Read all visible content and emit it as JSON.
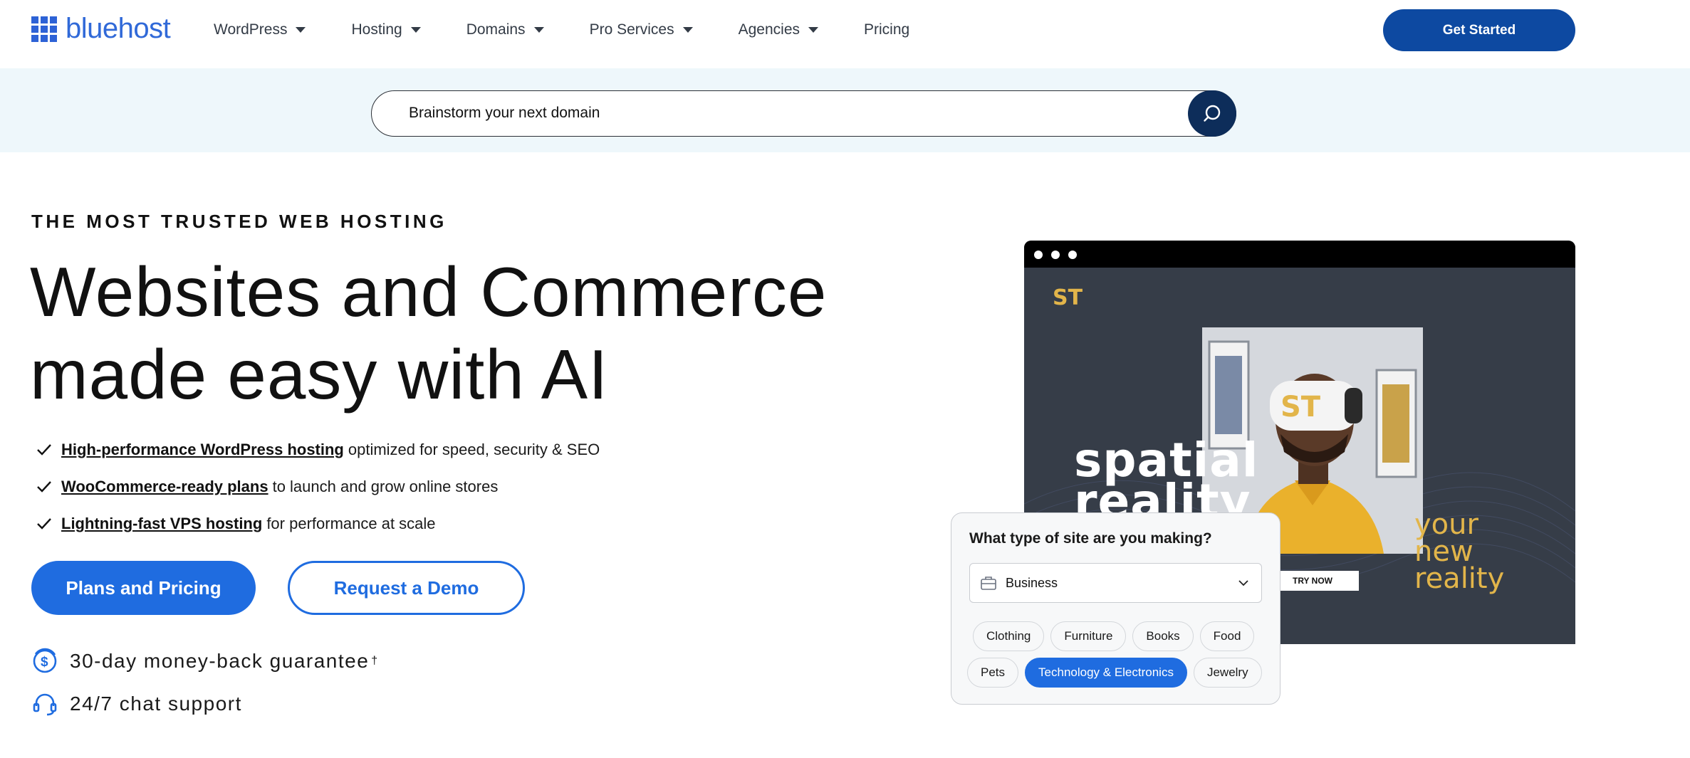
{
  "header": {
    "logo_text": "bluehost",
    "nav": [
      {
        "label": "WordPress",
        "has_dropdown": true
      },
      {
        "label": "Hosting",
        "has_dropdown": true
      },
      {
        "label": "Domains",
        "has_dropdown": true
      },
      {
        "label": "Pro Services",
        "has_dropdown": true
      },
      {
        "label": "Agencies",
        "has_dropdown": true
      },
      {
        "label": "Pricing",
        "has_dropdown": false
      }
    ],
    "cta_label": "Get Started"
  },
  "search": {
    "value": "Brainstorm your next domain",
    "icon": "search-icon"
  },
  "hero": {
    "eyebrow": "THE MOST TRUSTED WEB HOSTING",
    "headline_line1": "Websites and Commerce",
    "headline_line2": "made easy with AI",
    "features": [
      {
        "link": "High-performance WordPress hosting",
        "text": "optimized for speed, security & SEO"
      },
      {
        "link": "WooCommerce-ready plans",
        "text": "to launch and grow online stores"
      },
      {
        "link": "Lightning-fast VPS hosting",
        "text": "for performance at scale"
      }
    ],
    "primary_button": "Plans and Pricing",
    "secondary_button": "Request a Demo",
    "guarantee": "30-day money-back guarantee",
    "guarantee_mark": "†",
    "support": "24/7 chat support"
  },
  "preview": {
    "logo_text": "ST",
    "headline_1": "spatial",
    "headline_2": "reality",
    "tagline_1": "your",
    "tagline_2": "new",
    "tagline_3": "reality",
    "cta": "TRY NOW"
  },
  "site_card": {
    "question": "What type of site are you making?",
    "selected": "Business",
    "chips_row1": [
      "Clothing",
      "Furniture",
      "Books",
      "Food"
    ],
    "chips_row2": [
      "Pets",
      "Technology & Electronics",
      "Jewelry"
    ],
    "active_chip": "Technology & Electronics"
  },
  "colors": {
    "brand_blue": "#1f6ce0",
    "navy": "#0d49a1",
    "search_band": "#eef7fb",
    "gold": "#e2b54a"
  }
}
